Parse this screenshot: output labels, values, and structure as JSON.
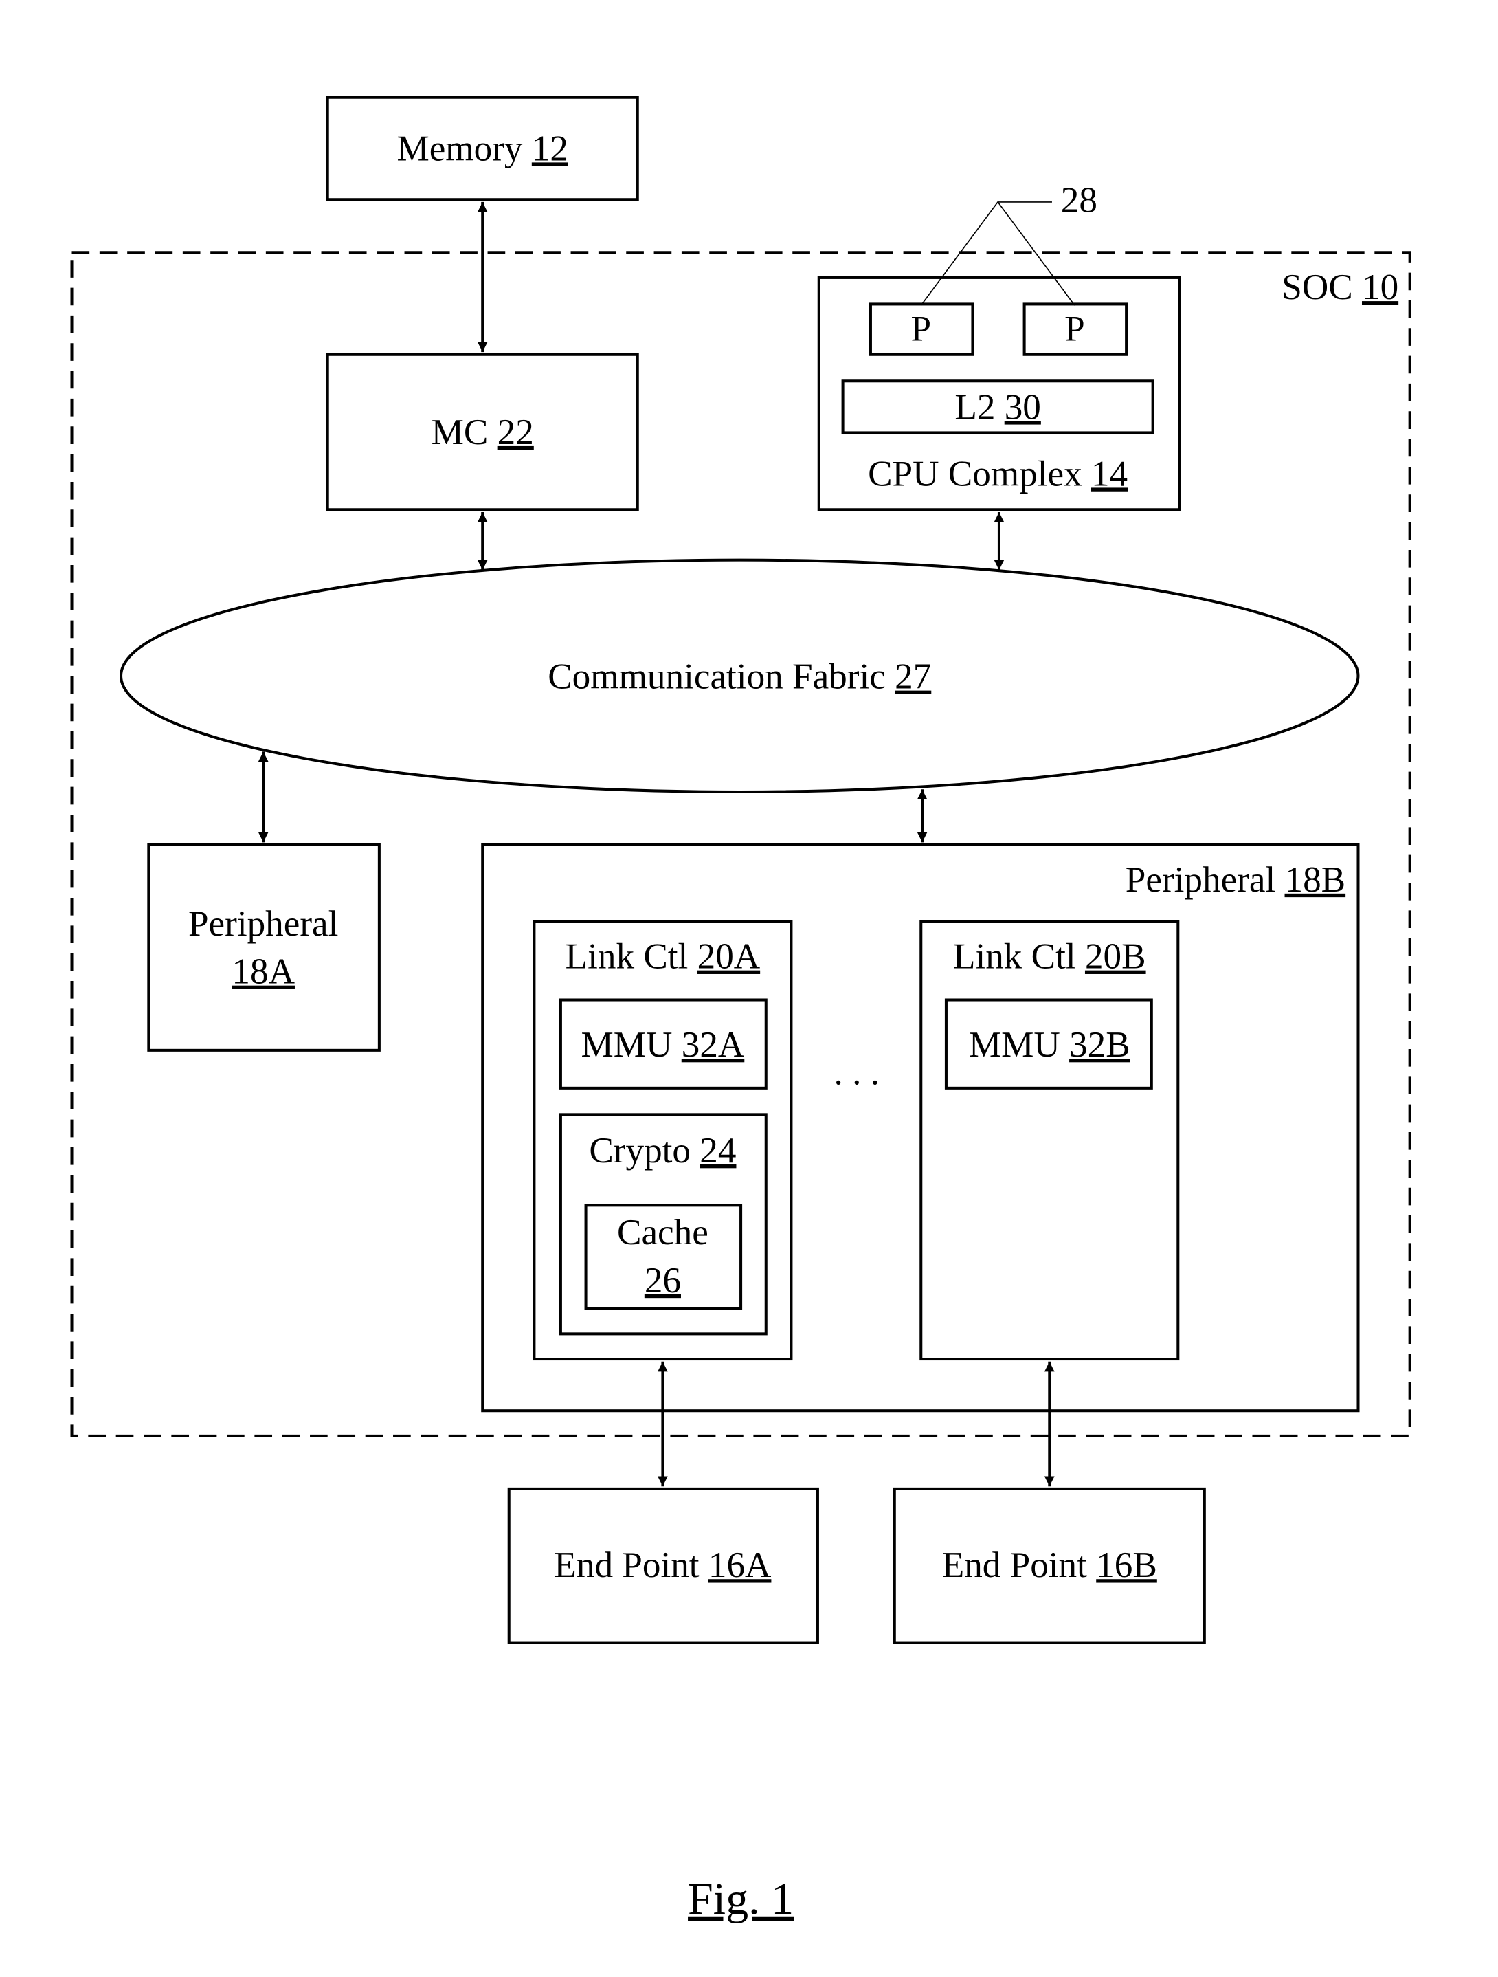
{
  "figure": {
    "caption": "Fig. 1",
    "soc": {
      "name": "SOC ",
      "ref": "10"
    },
    "memory": {
      "name": "Memory ",
      "ref": "12"
    },
    "mc": {
      "name": "MC ",
      "ref": "22"
    },
    "cpu_complex": {
      "name": "CPU Complex ",
      "ref": "14"
    },
    "processors": {
      "label": "P",
      "ref": "28"
    },
    "l2": {
      "name": "L2 ",
      "ref": "30"
    },
    "fabric": {
      "name": "Communication Fabric ",
      "ref": "27"
    },
    "peripheral_a": {
      "name": "Peripheral",
      "ref": "18A"
    },
    "peripheral_b": {
      "name": "Peripheral ",
      "ref": "18B"
    },
    "link_ctl_a": {
      "name": "Link Ctl ",
      "ref": "20A"
    },
    "link_ctl_b": {
      "name": "Link Ctl ",
      "ref": "20B"
    },
    "mmu_a": {
      "name": "MMU ",
      "ref": "32A"
    },
    "mmu_b": {
      "name": "MMU ",
      "ref": "32B"
    },
    "crypto": {
      "name": "Crypto ",
      "ref": "24"
    },
    "cache": {
      "name": "Cache",
      "ref": "26"
    },
    "ellipsis": ". . .",
    "endpoint_a": {
      "name": "End Point ",
      "ref": "16A"
    },
    "endpoint_b": {
      "name": "End Point ",
      "ref": "16B"
    }
  }
}
